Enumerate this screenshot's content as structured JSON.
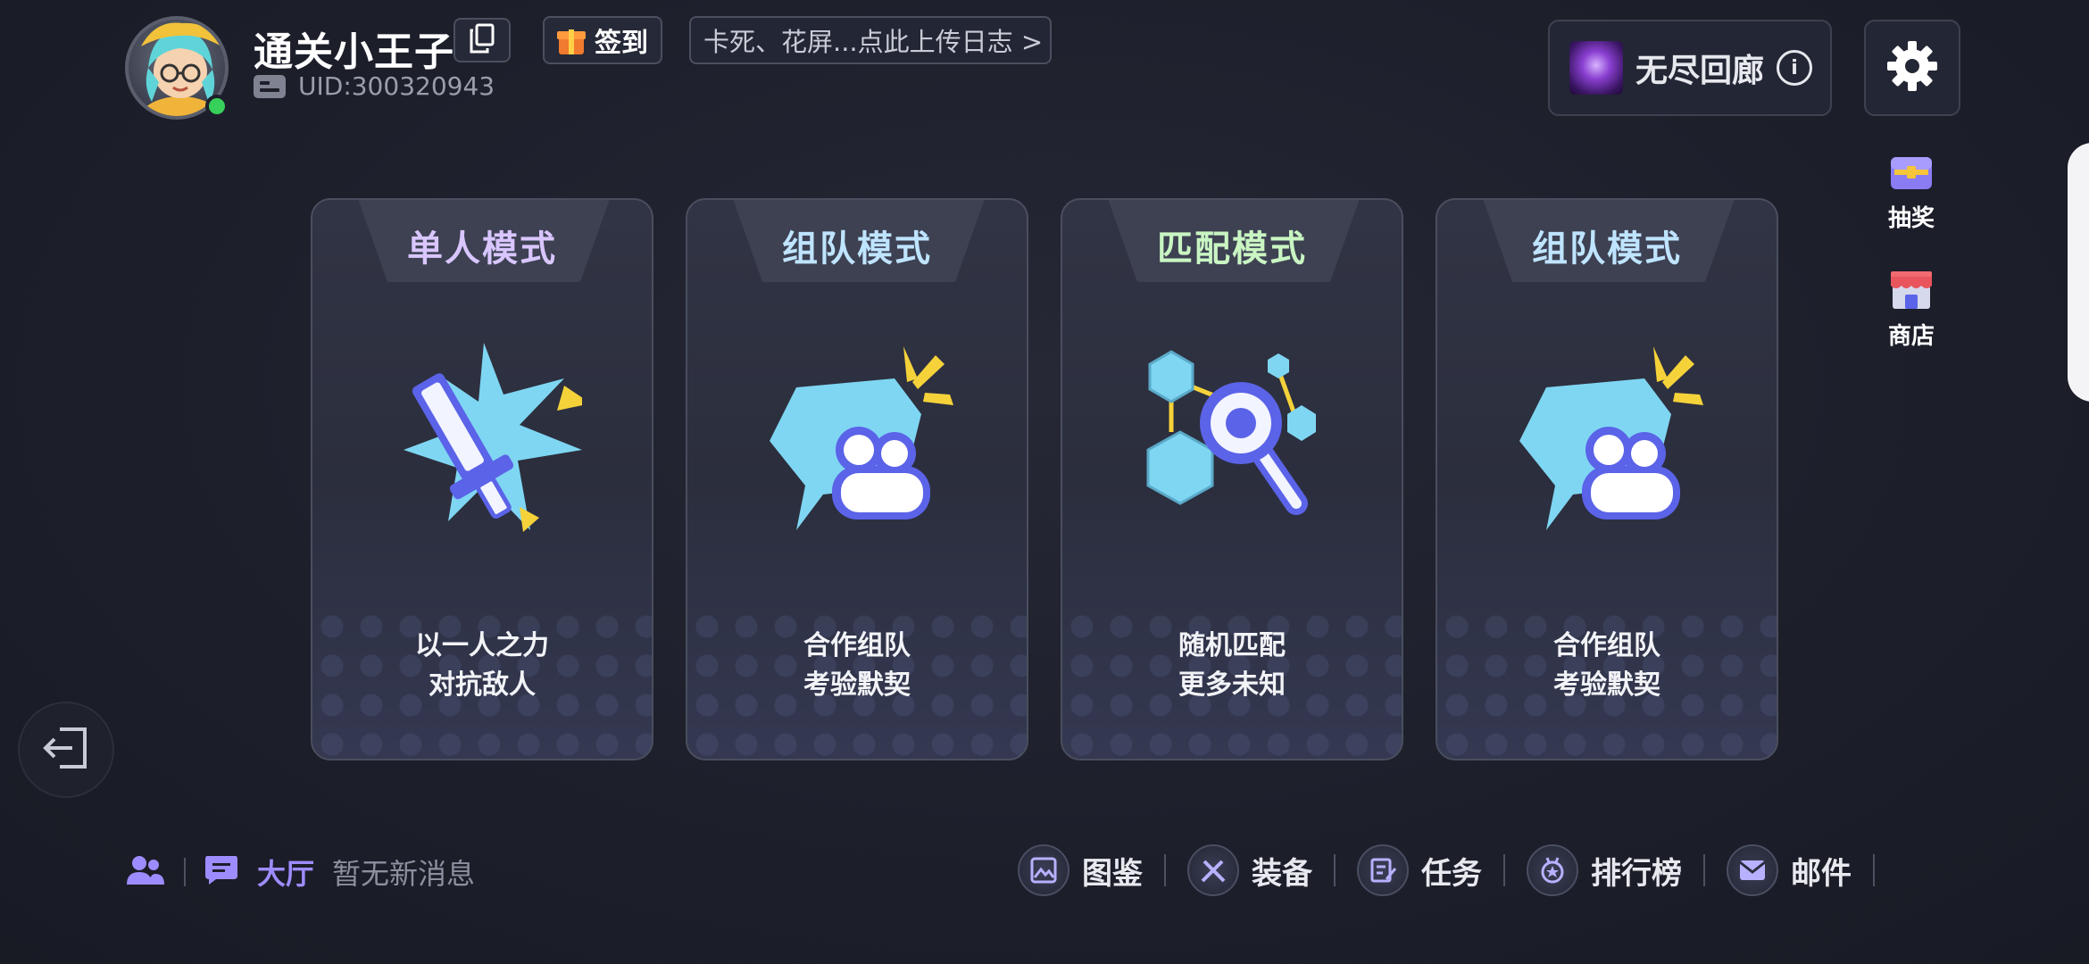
{
  "profile": {
    "username": "通关小王子",
    "uid": "UID:300320943",
    "online": true
  },
  "header": {
    "signin_label": "签到",
    "log_upload_text": "卡死、花屏...点此上传日志 >",
    "endless_label": "无尽回廊",
    "info_glyph": "i"
  },
  "side_menu": [
    {
      "label": "抽奖",
      "icon": "treasure-chest-icon"
    },
    {
      "label": "商店",
      "icon": "shop-icon"
    }
  ],
  "modes": [
    {
      "title": "单人模式",
      "desc1": "以一人之力",
      "desc2": "对抗敌人",
      "title_color": "#d9c6ff",
      "icon": "sword-icon"
    },
    {
      "title": "组队模式",
      "desc1": "合作组队",
      "desc2": "考验默契",
      "title_color": "#bfe4ff",
      "icon": "team-chat-icon"
    },
    {
      "title": "匹配模式",
      "desc1": "随机匹配",
      "desc2": "更多未知",
      "title_color": "#c9f5c2",
      "icon": "match-search-icon"
    },
    {
      "title": "组队模式",
      "desc1": "合作组队",
      "desc2": "考验默契",
      "title_color": "#bfe4ff",
      "icon": "team-chat-icon"
    }
  ],
  "bottom": {
    "hall_label": "大厅",
    "hall_message": "暂无新消息",
    "nav": [
      {
        "label": "图鉴",
        "icon": "album-icon"
      },
      {
        "label": "装备",
        "icon": "equipment-icon"
      },
      {
        "label": "任务",
        "icon": "task-icon"
      },
      {
        "label": "排行榜",
        "icon": "ranking-icon"
      },
      {
        "label": "邮件",
        "icon": "mail-icon"
      }
    ]
  },
  "colors": {
    "accent_purple": "#9d8cff",
    "online_green": "#37d05a",
    "icon_cyan": "#7fd6f2",
    "icon_blue": "#5b63e8",
    "icon_yellow": "#f5d23a"
  }
}
